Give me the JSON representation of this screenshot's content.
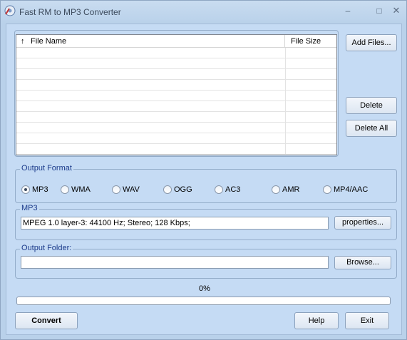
{
  "window": {
    "title": "Fast RM to MP3 Converter",
    "minimize_symbol": "–",
    "maximize_symbol": "□",
    "close_symbol": "✕"
  },
  "file_list": {
    "sort_symbol": "↑",
    "columns": [
      "File Name",
      "File Size"
    ],
    "rows": []
  },
  "buttons": {
    "add_files": "Add Files...",
    "delete": "Delete",
    "delete_all": "Delete All",
    "properties": "properties...",
    "browse": "Browse...",
    "convert": "Convert",
    "help": "Help",
    "exit": "Exit"
  },
  "output_format": {
    "label": "Output Format",
    "selected": "MP3",
    "options": [
      "MP3",
      "WMA",
      "WAV",
      "OGG",
      "AC3",
      "AMR",
      "MP4/AAC"
    ]
  },
  "format_settings": {
    "label": "MP3",
    "value": "MPEG 1.0 layer-3: 44100 Hz; Stereo;  128 Kbps;"
  },
  "output_folder": {
    "label": "Output Folder:",
    "value": ""
  },
  "progress": {
    "text": "0%",
    "percent": 0
  }
}
